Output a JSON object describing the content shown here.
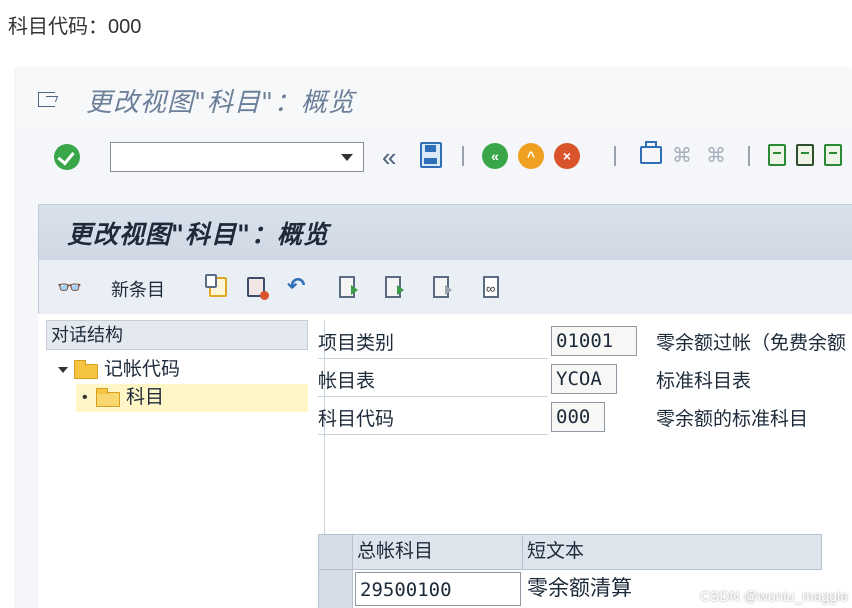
{
  "caption": "科目代码：000",
  "window": {
    "title": "更改视图\"科目\"：概览"
  },
  "toolbar": {
    "command_field_value": "",
    "back_glyph": "«"
  },
  "panel": {
    "title": "更改视图\"科目\"：概览",
    "new_entries_label": "新条目"
  },
  "nav_tree": {
    "header": "对话结构",
    "items": [
      {
        "label": "记帐代码",
        "level": 0,
        "expanded": true,
        "selected": false
      },
      {
        "label": "科目",
        "level": 1,
        "expanded": false,
        "selected": true
      }
    ]
  },
  "fields": [
    {
      "label": "项目类别",
      "value": "01001",
      "description": "零余额过帐（免费余额"
    },
    {
      "label": "帐目表",
      "value": "YCOA",
      "description": "标准科目表"
    },
    {
      "label": "科目代码",
      "value": "000",
      "description": "零余额的标准科目"
    }
  ],
  "table": {
    "columns": [
      "总帐科目",
      "短文本"
    ],
    "rows": [
      {
        "account": "29500100",
        "short_text": "零余额清算"
      }
    ]
  },
  "watermark": "CSDN @woniu_maggie",
  "colors": {
    "panel_header": "#d9e2ec",
    "tree_selected": "#fff6c8",
    "folder": "#f5c542",
    "ok_green": "#3aa64a"
  }
}
